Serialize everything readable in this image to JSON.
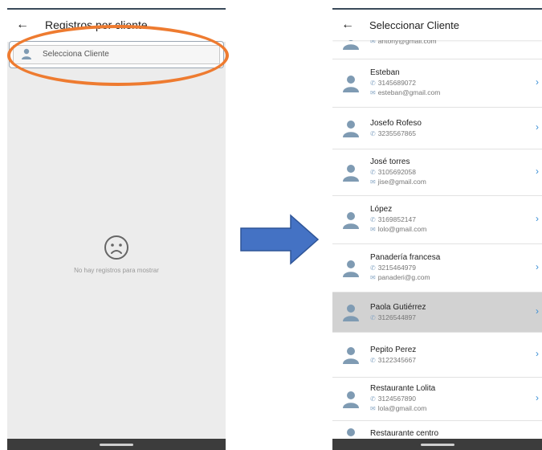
{
  "left_screen": {
    "title": "Registros por cliente",
    "selector_label": "Selecciona Cliente",
    "empty_message": "No hay registros para mostrar"
  },
  "right_screen": {
    "title": "Seleccionar Cliente",
    "clients": [
      {
        "name": "",
        "phone": "",
        "email": "antony@gmail.com"
      },
      {
        "name": "Esteban",
        "phone": "3145689072",
        "email": "esteban@gmail.com"
      },
      {
        "name": "Josefo Rofeso",
        "phone": "3235567865",
        "email": ""
      },
      {
        "name": "José torres",
        "phone": "3105692058",
        "email": "jise@gmail.com"
      },
      {
        "name": "López",
        "phone": "3169852147",
        "email": "lolo@gmail.com"
      },
      {
        "name": "Panadería francesa",
        "phone": "3215464979",
        "email": "panaderi@g.com"
      },
      {
        "name": "Paola Gutiérrez",
        "phone": "3126544897",
        "email": ""
      },
      {
        "name": "Pepito Perez",
        "phone": "3122345667",
        "email": ""
      },
      {
        "name": "Restaurante Lolita",
        "phone": "3124567890",
        "email": "lola@gmail.com"
      },
      {
        "name": "Restaurante centro",
        "phone": "",
        "email": ""
      }
    ],
    "selected_client": "Paola Gutiérrez"
  },
  "icons": {
    "back": "arrow-left-icon",
    "person": "person-icon",
    "phone": "phone-icon",
    "email": "mail-icon",
    "chevron": "chevron-right-icon",
    "sad": "sad-face-icon"
  },
  "colors": {
    "highlight": "#ee7b30",
    "arrow": "#4472c4",
    "avatar": "#7f9bb3",
    "chevron": "#3b8fd6",
    "selected_row": "#d2d2d2"
  }
}
